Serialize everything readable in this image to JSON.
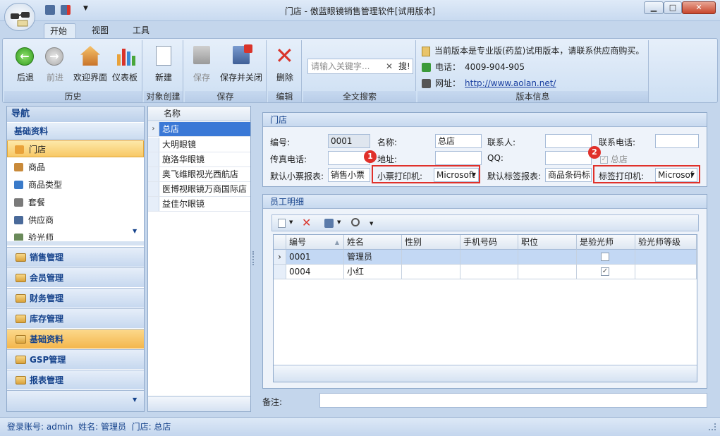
{
  "window": {
    "title": "门店 - 傲蓝眼镜销售管理软件[试用版本]",
    "minimize": "▁",
    "maximize": "□",
    "close": "✕"
  },
  "ribbon_tabs": [
    "开始",
    "视图",
    "工具"
  ],
  "ribbon": {
    "history": {
      "label": "历史",
      "back": "后退",
      "forward": "前进",
      "welcome": "欢迎界面",
      "dashboard": "仪表板"
    },
    "create": {
      "label": "对象创建",
      "new": "新建"
    },
    "save": {
      "label": "保存",
      "save": "保存",
      "save_close": "保存并关闭"
    },
    "edit": {
      "label": "编辑",
      "delete": "删除"
    },
    "search": {
      "label": "全文搜索",
      "placeholder": "请输入关键字...",
      "button": "搜!",
      "clear": "✕"
    },
    "info": {
      "label": "版本信息",
      "notice": "当前版本是专业版(药监)试用版本，请联系供应商购买。",
      "phone_label": "电话：",
      "phone": "4009-904-905",
      "site_label": "网址：",
      "site": "http://www.aolan.net/"
    }
  },
  "nav": {
    "title": "导航",
    "section": "基础资料",
    "items": [
      "门店",
      "商品",
      "商品类型",
      "套餐",
      "供应商",
      "验光师"
    ],
    "groups": [
      "销售管理",
      "会员管理",
      "财务管理",
      "库存管理",
      "基础资料",
      "GSP管理",
      "报表管理"
    ]
  },
  "list": {
    "header": "名称",
    "rows": [
      "总店",
      "大明眼镜",
      "施洛华眼镜",
      "奥飞维眼视光西航店",
      "医博视眼镜万商国际店",
      "益佳尔眼镜"
    ]
  },
  "store": {
    "title": "门店",
    "code_label": "编号:",
    "code": "0001",
    "name_label": "名称:",
    "name": "总店",
    "contact_label": "联系人:",
    "contact": "",
    "tel_label": "联系电话:",
    "tel": "",
    "fax_label": "传真电话:",
    "fax": "",
    "addr_label": "地址:",
    "addr": "",
    "qq_label": "QQ:",
    "qq": "",
    "hq_label": "总店",
    "receipt_report_label": "默认小票报表:",
    "receipt_report": "销售小票",
    "receipt_printer_label": "小票打印机:",
    "receipt_printer": "Microsoft",
    "tag_report_label": "默认标签报表:",
    "tag_report": "商品条码标",
    "tag_printer_label": "标签打印机:",
    "tag_printer": "Microsof",
    "badge1": "1",
    "badge2": "2"
  },
  "employees": {
    "title": "员工明细",
    "columns": [
      "编号",
      "姓名",
      "性别",
      "手机号码",
      "职位",
      "是验光师",
      "验光师等级"
    ],
    "rows": [
      {
        "code": "0001",
        "name": "管理员",
        "gender": "",
        "phone": "",
        "position": "",
        "optometrist": false,
        "level": ""
      },
      {
        "code": "0004",
        "name": "小红",
        "gender": "",
        "phone": "",
        "position": "",
        "optometrist": true,
        "level": ""
      }
    ]
  },
  "remark_label": "备注:",
  "status": "登录账号: admin  姓名: 管理员  门店: 总店"
}
